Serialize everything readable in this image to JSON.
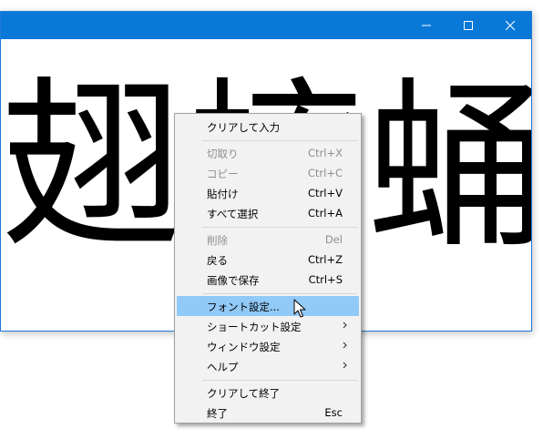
{
  "window": {
    "kanji_text": "翅蟀蛹蝣"
  },
  "context_menu": {
    "items": [
      {
        "label": "クリアして入力",
        "shortcut": "",
        "disabled": false,
        "submenu": false
      },
      {
        "label": "切取り",
        "shortcut": "Ctrl+X",
        "disabled": true,
        "submenu": false
      },
      {
        "label": "コピー",
        "shortcut": "Ctrl+C",
        "disabled": true,
        "submenu": false
      },
      {
        "label": "貼付け",
        "shortcut": "Ctrl+V",
        "disabled": false,
        "submenu": false
      },
      {
        "label": "すべて選択",
        "shortcut": "Ctrl+A",
        "disabled": false,
        "submenu": false
      },
      {
        "label": "削除",
        "shortcut": "Del",
        "disabled": true,
        "submenu": false
      },
      {
        "label": "戻る",
        "shortcut": "Ctrl+Z",
        "disabled": false,
        "submenu": false
      },
      {
        "label": "画像で保存",
        "shortcut": "Ctrl+S",
        "disabled": false,
        "submenu": false
      },
      {
        "label": "フォント設定...",
        "shortcut": "",
        "disabled": false,
        "submenu": false,
        "highlighted": true
      },
      {
        "label": "ショートカット設定",
        "shortcut": "",
        "disabled": false,
        "submenu": true
      },
      {
        "label": "ウィンドウ設定",
        "shortcut": "",
        "disabled": false,
        "submenu": true
      },
      {
        "label": "ヘルプ",
        "shortcut": "",
        "disabled": false,
        "submenu": true
      },
      {
        "label": "クリアして終了",
        "shortcut": "",
        "disabled": false,
        "submenu": false
      },
      {
        "label": "終了",
        "shortcut": "Esc",
        "disabled": false,
        "submenu": false
      }
    ]
  },
  "colors": {
    "titlebar": "#0a78d7",
    "menu_bg": "#f2f2f2",
    "highlight": "#91c9f7",
    "disabled_text": "#8e8e8e"
  },
  "icons": [
    "minimize-icon",
    "maximize-icon",
    "close-icon",
    "submenu-arrow-icon",
    "mouse-cursor-icon"
  ]
}
